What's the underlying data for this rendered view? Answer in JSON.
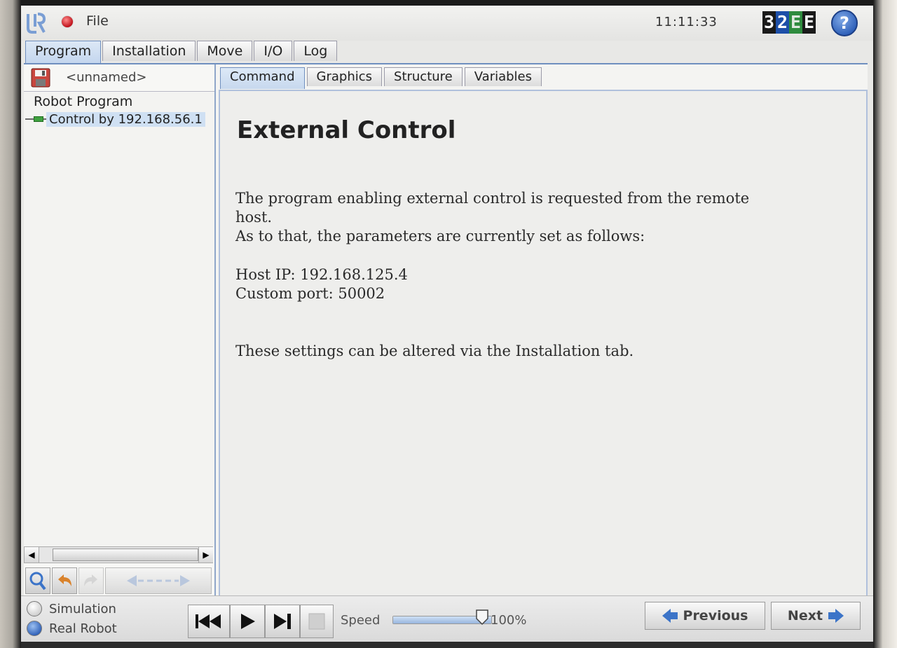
{
  "topbar": {
    "file_menu": "File",
    "clock": "11:11:33",
    "version_badge": [
      {
        "char": "3",
        "bg": "#1a1a1a",
        "fg": "#ffffff"
      },
      {
        "char": "2",
        "bg": "#1d4fa8",
        "fg": "#ffffff"
      },
      {
        "char": "E",
        "bg": "#2e8b3e",
        "fg": "#dfe8df"
      },
      {
        "char": "E",
        "bg": "#1a1a1a",
        "fg": "#ffffff"
      }
    ],
    "help_icon": "?"
  },
  "main_tabs": [
    "Program",
    "Installation",
    "Move",
    "I/O",
    "Log"
  ],
  "active_main_tab": "Program",
  "program": {
    "name": "<unnamed>",
    "tree_root": "Robot Program",
    "tree_child": "Control by 192.168.56.1"
  },
  "sub_tabs": [
    "Command",
    "Graphics",
    "Structure",
    "Variables"
  ],
  "active_sub_tab": "Command",
  "command": {
    "heading": "External Control",
    "line1": "The program enabling external control is requested from the remote",
    "line2": "host.",
    "line3": "As to that, the parameters are currently set as follows:",
    "host_ip": "Host IP: 192.168.125.4",
    "custom_port": "Custom port: 50002",
    "footer": "These settings can be altered via the Installation tab."
  },
  "bottom": {
    "simulation_label": "Simulation",
    "real_robot_label": "Real Robot",
    "speed_label": "Speed",
    "speed_value": "100%",
    "speed_fraction": 1.0,
    "previous_label": "Previous",
    "next_label": "Next"
  },
  "colors": {
    "accent_blue": "#3c74c8",
    "record_red": "#c0121b",
    "tree_selected": "#cfe0f3"
  }
}
